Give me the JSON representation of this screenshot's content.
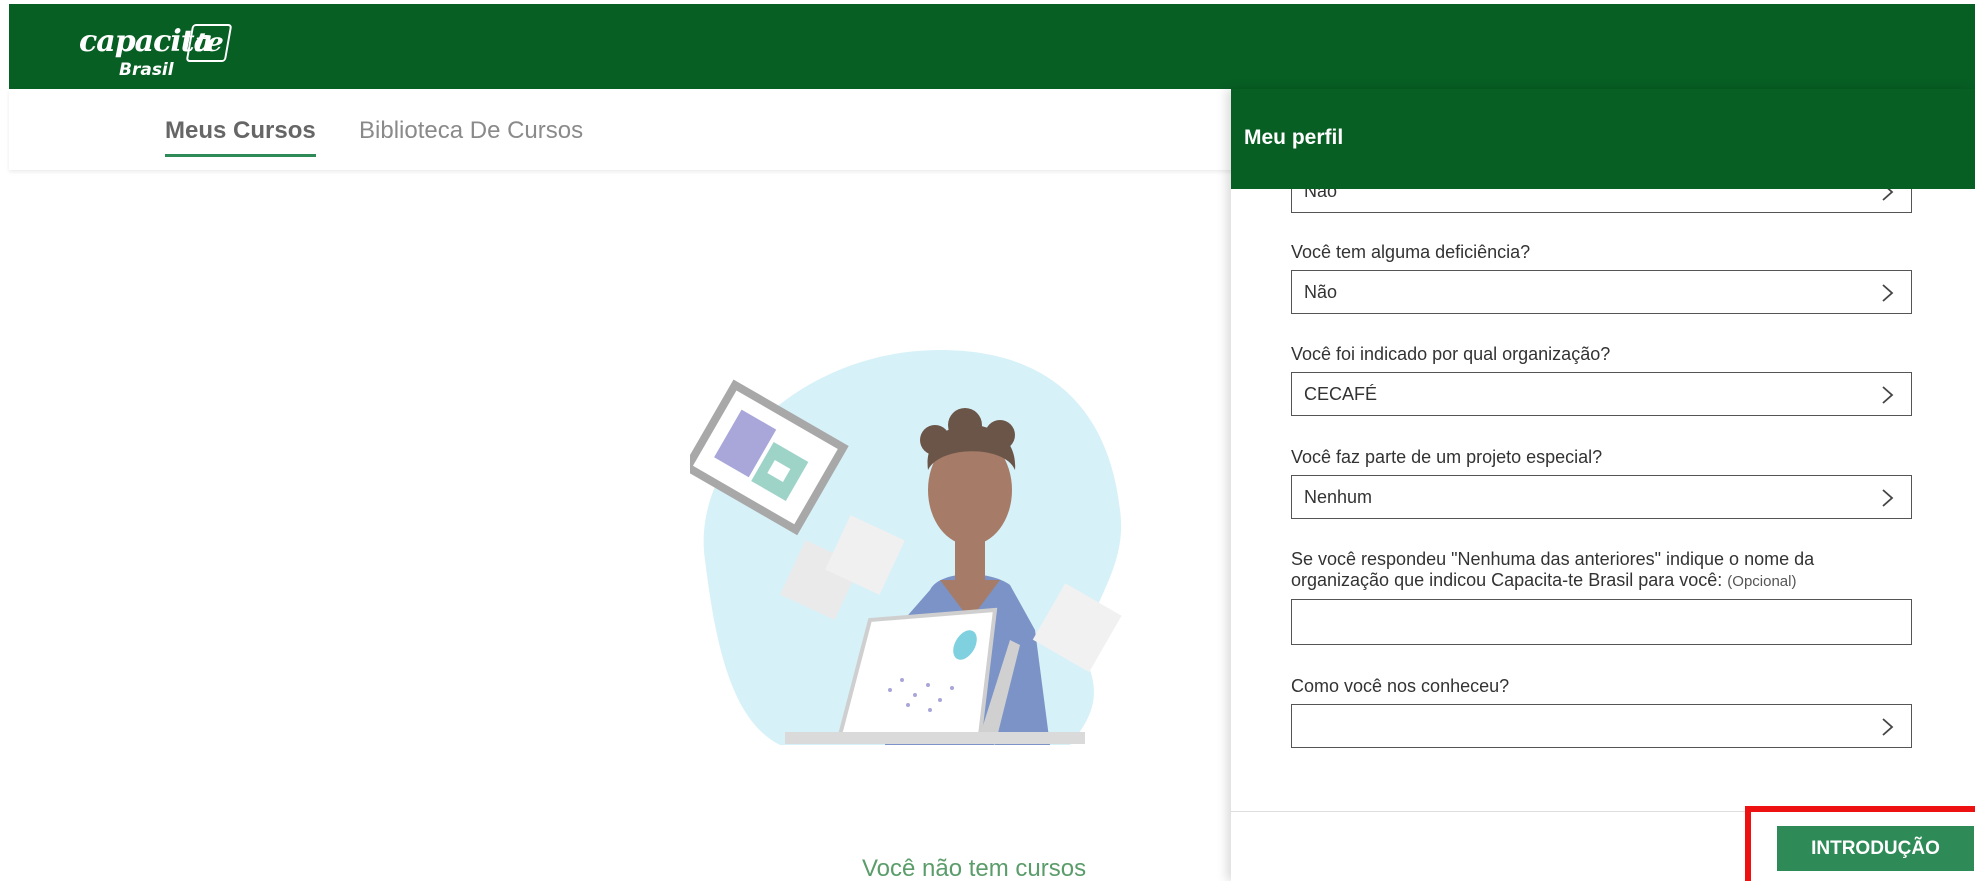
{
  "brand": {
    "logo_word": "capacita",
    "logo_te": "te",
    "logo_sub": "Brasil"
  },
  "tabs": [
    {
      "label": "Meus Cursos",
      "active": true
    },
    {
      "label": "Biblioteca De Cursos",
      "active": false
    }
  ],
  "main": {
    "empty_message": "Você não tem cursos"
  },
  "panel": {
    "title": "Meu perfil",
    "top_partial_value": "Não",
    "fields": [
      {
        "label": "Você tem alguma deficiência?",
        "value": "Não"
      },
      {
        "label": "Você foi indicado por qual organização?",
        "value": "CECAFÉ"
      },
      {
        "label": "Você faz parte de um projeto especial?",
        "value": "Nenhum"
      }
    ],
    "org_text": {
      "line1": "Se você respondeu \"Nenhuma das anteriores\" indique o nome da",
      "line2": "organização que indicou Capacita-te Brasil para você:",
      "optional": "(Opcional)",
      "value": ""
    },
    "how": {
      "label": "Como você nos conheceu?",
      "value": ""
    },
    "button_label": "INTRODUÇÃO"
  },
  "colors": {
    "header_green": "#075f24",
    "button_green": "#2e8b57",
    "highlight_red": "#ee1111"
  }
}
